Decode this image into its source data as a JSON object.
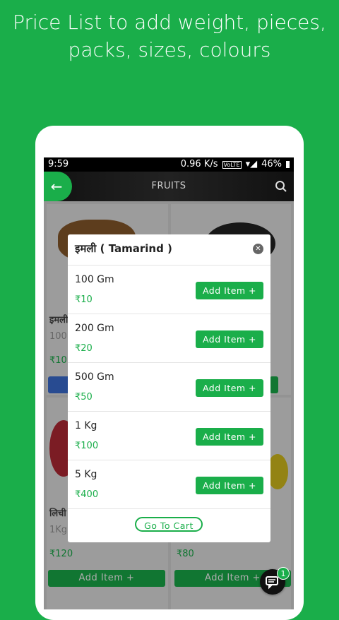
{
  "promo": {
    "line1": "Price List to add weight, pieces,",
    "line2": "packs, sizes, colours"
  },
  "status_bar": {
    "time": "9:59",
    "speed": "0.96 K/s",
    "network": "VoLTE",
    "battery": "46%"
  },
  "app_bar": {
    "title": "FRUITS",
    "back_icon": "arrow-left-icon",
    "search_icon": "search-icon"
  },
  "background_products": {
    "left_top": {
      "name": "इमली",
      "weight": "100",
      "price": "₹10"
    },
    "left_bottom": {
      "name": "लिची",
      "weight": "1Kg",
      "price": "₹120",
      "button": "Add Item +"
    },
    "right_bottom": {
      "price": "₹80",
      "button": "Add Item +"
    }
  },
  "dialog": {
    "title": "इमली ( Tamarind )",
    "close_icon": "close-icon",
    "options": [
      {
        "size": "100 Gm",
        "price": "₹10",
        "button": "Add Item +"
      },
      {
        "size": "200 Gm",
        "price": "₹20",
        "button": "Add Item +"
      },
      {
        "size": "500 Gm",
        "price": "₹50",
        "button": "Add Item +"
      },
      {
        "size": "1 Kg",
        "price": "₹100",
        "button": "Add Item +"
      },
      {
        "size": "5 Kg",
        "price": "₹400",
        "button": "Add Item +"
      }
    ],
    "go_to_cart": "Go To Cart"
  },
  "chat": {
    "badge": "1",
    "icon": "chat-icon"
  },
  "colors": {
    "brand_green": "#1aae4a",
    "dark_bar": "#111111"
  }
}
